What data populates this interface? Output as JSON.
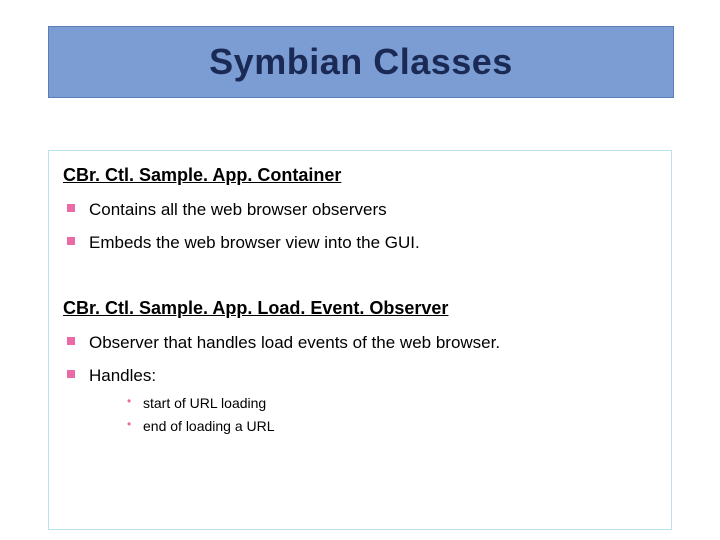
{
  "title": "Symbian Classes",
  "section1": {
    "heading": "CBr. Ctl. Sample. App. Container",
    "items": [
      "Contains all the web browser observers",
      "Embeds the web browser view into the GUI."
    ]
  },
  "section2": {
    "heading": "CBr. Ctl. Sample. App. Load. Event. Observer",
    "items": [
      "Observer that handles load events of the web browser.",
      "Handles:"
    ],
    "subitems": [
      "start of URL loading",
      "end of loading a URL"
    ]
  }
}
